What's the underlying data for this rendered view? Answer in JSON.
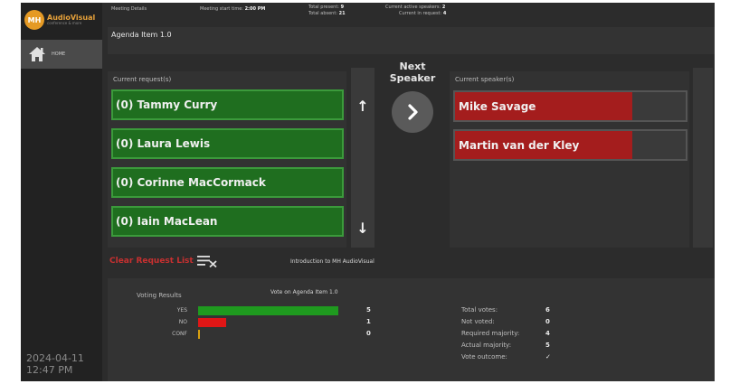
{
  "sidebar": {
    "logo_badge": "MH",
    "logo_name": "AudioVisual",
    "logo_sub": "conference & more",
    "home_label": "HOME",
    "date": "2024-04-11",
    "time": "12:47 PM"
  },
  "header": {
    "meeting_details": "Meeting Details",
    "meeting_start_label": "Meeting start time:",
    "meeting_start_value": "2:00 PM",
    "total_present_label": "Total present:",
    "total_present_value": "9",
    "total_absent_label": "Total absent:",
    "total_absent_value": "21",
    "active_speakers_label": "Current active speakers:",
    "active_speakers_value": "2",
    "in_request_label": "Current in request:",
    "in_request_value": "4",
    "agenda_item": "Agenda Item 1.0"
  },
  "requests": {
    "title": "Current request(s)",
    "items": [
      "(0) Tammy Curry",
      "(0) Laura Lewis",
      "(0) Corinne MacCormack",
      "(0) Iain MacLean"
    ],
    "up_arrow": "↑",
    "down_arrow": "↓",
    "clear_label": "Clear Request List"
  },
  "next_speaker": {
    "label_line1": "Next",
    "label_line2": "Speaker"
  },
  "speakers": {
    "title": "Current speaker(s)",
    "items": [
      "Mike Savage",
      "Martin van der Kley"
    ]
  },
  "intro_text": "Introduction to MH AudioVisual",
  "voting": {
    "title": "Voting Results",
    "agenda": "Vote on Agenda Item 1.0",
    "rows": [
      {
        "label": "YES",
        "count": "5",
        "value": 5,
        "color": "#1f9a1f"
      },
      {
        "label": "NO",
        "count": "1",
        "value": 1,
        "color": "#e01616"
      },
      {
        "label": "CONF",
        "count": "0",
        "value": 0,
        "color": "#d8a010"
      }
    ],
    "stats": [
      {
        "label": "Total votes:",
        "value": "6"
      },
      {
        "label": "Not voted:",
        "value": "0"
      },
      {
        "label": "Required majority:",
        "value": "4"
      },
      {
        "label": "Actual majority:",
        "value": "5"
      },
      {
        "label": "Vote outcome:",
        "value": "✓"
      }
    ]
  },
  "colors": {
    "request_green": "#1f6e1f",
    "speaker_red": "#a41d1d",
    "clear_red": "#c83030",
    "logo_orange": "#e59a25"
  }
}
